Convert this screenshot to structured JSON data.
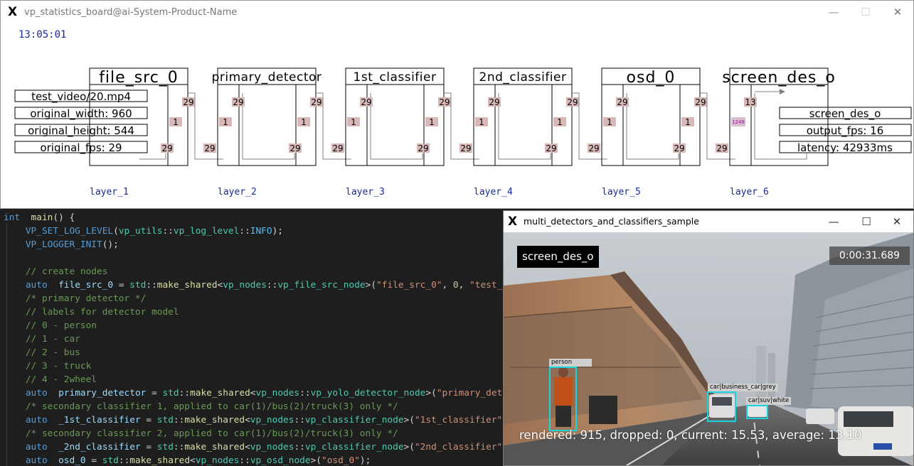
{
  "stats_window": {
    "title": "vp_statistics_board@ai-System-Product-Name",
    "clock": "13:05:01",
    "controls": {
      "minimize": "—",
      "maximize": "☐",
      "close": "✕"
    }
  },
  "pipeline": {
    "nodes": [
      {
        "name": "file_src_0",
        "layer": "layer_1",
        "in_queue": "",
        "in_count": "",
        "out_count": "29",
        "out_queue": "29",
        "mid_count": "1",
        "mid_count_right": "",
        "top_count": "29",
        "top_count_left": ""
      },
      {
        "name": "primary_detector",
        "layer": "layer_2",
        "in_count": "29",
        "mid_count_left": "1",
        "top_count_left": "29",
        "top_count": "29",
        "mid_count": "1",
        "out_count": "29"
      },
      {
        "name": "1st_classifier",
        "layer": "layer_3",
        "in_count": "29",
        "mid_count_left": "1",
        "top_count_left": "29",
        "top_count": "29",
        "mid_count": "1",
        "out_count": "29"
      },
      {
        "name": "2nd_classifier",
        "layer": "layer_4",
        "in_count": "29",
        "mid_count_left": "1",
        "top_count_left": "29",
        "top_count": "29",
        "mid_count": "1",
        "out_count": "29"
      },
      {
        "name": "osd_0",
        "layer": "layer_5",
        "in_count": "29",
        "mid_count_left": "1",
        "top_count_left": "29",
        "top_count": "29",
        "mid_count": "1",
        "out_count": "29"
      },
      {
        "name": "screen_des_o",
        "layer": "layer_6",
        "in_count": "29",
        "mid_count_left": "1248",
        "top_count_left": "13"
      }
    ],
    "src_info": [
      "test_video/20.mp4",
      "original_width: 960",
      "original_height: 544",
      "original_fps: 29"
    ],
    "des_info": [
      "screen_des_o",
      "output_fps: 16",
      "latency: 42933ms"
    ]
  },
  "code": {
    "lines": [
      [
        [
          "kw",
          "int"
        ],
        [
          "",
          "  "
        ],
        [
          "fn",
          "main"
        ],
        [
          "",
          "() {"
        ]
      ],
      [
        [
          "",
          "    "
        ],
        [
          "mac",
          "VP_SET_LOG_LEVEL"
        ],
        [
          "",
          "("
        ],
        [
          "ty",
          "vp_utils"
        ],
        [
          "",
          "::"
        ],
        [
          "ty",
          "vp_log_level"
        ],
        [
          "",
          "::"
        ],
        [
          "en",
          "INFO"
        ],
        [
          "",
          ");"
        ]
      ],
      [
        [
          "",
          "    "
        ],
        [
          "mac",
          "VP_LOGGER_INIT"
        ],
        [
          "",
          "();"
        ]
      ],
      [
        [
          "",
          ""
        ]
      ],
      [
        [
          "",
          "    "
        ],
        [
          "cmt",
          "// create nodes"
        ]
      ],
      [
        [
          "",
          "    "
        ],
        [
          "kw",
          "auto"
        ],
        [
          "",
          "  "
        ],
        [
          "var",
          "file_src_0"
        ],
        [
          "",
          " = "
        ],
        [
          "ty",
          "std"
        ],
        [
          "",
          "::"
        ],
        [
          "fn",
          "make_shared"
        ],
        [
          "",
          "<"
        ],
        [
          "ty",
          "vp_nodes"
        ],
        [
          "",
          "::"
        ],
        [
          "ty",
          "vp_file_src_node"
        ],
        [
          "",
          ">("
        ],
        [
          "str",
          "\"file_src_0\""
        ],
        [
          "",
          ", "
        ],
        [
          "num",
          "0"
        ],
        [
          "",
          ", "
        ],
        [
          "str",
          "\"test_v"
        ]
      ],
      [
        [
          "",
          "    "
        ],
        [
          "cmt",
          "/* primary detector */"
        ]
      ],
      [
        [
          "",
          "    "
        ],
        [
          "cmt",
          "// labels for detector model"
        ]
      ],
      [
        [
          "",
          "    "
        ],
        [
          "cmt",
          "// 0 - person"
        ]
      ],
      [
        [
          "",
          "    "
        ],
        [
          "cmt",
          "// 1 - car"
        ]
      ],
      [
        [
          "",
          "    "
        ],
        [
          "cmt",
          "// 2 - bus"
        ]
      ],
      [
        [
          "",
          "    "
        ],
        [
          "cmt",
          "// 3 - truck"
        ]
      ],
      [
        [
          "",
          "    "
        ],
        [
          "cmt",
          "// 4 - 2wheel"
        ]
      ],
      [
        [
          "",
          "    "
        ],
        [
          "kw",
          "auto"
        ],
        [
          "",
          "  "
        ],
        [
          "var",
          "primary_detector"
        ],
        [
          "",
          " = "
        ],
        [
          "ty",
          "std"
        ],
        [
          "",
          "::"
        ],
        [
          "fn",
          "make_shared"
        ],
        [
          "",
          "<"
        ],
        [
          "ty",
          "vp_nodes"
        ],
        [
          "",
          "::"
        ],
        [
          "ty",
          "vp_yolo_detector_node"
        ],
        [
          "",
          ">("
        ],
        [
          "str",
          "\"primary_dete"
        ]
      ],
      [
        [
          "",
          "    "
        ],
        [
          "cmt",
          "/* secondary classifier 1, applied to car(1)/bus(2)/truck(3) only */"
        ]
      ],
      [
        [
          "",
          "    "
        ],
        [
          "kw",
          "auto"
        ],
        [
          "",
          "  "
        ],
        [
          "var",
          "_1st_classifier"
        ],
        [
          "",
          " = "
        ],
        [
          "ty",
          "std"
        ],
        [
          "",
          "::"
        ],
        [
          "fn",
          "make_shared"
        ],
        [
          "",
          "<"
        ],
        [
          "ty",
          "vp_nodes"
        ],
        [
          "",
          "::"
        ],
        [
          "ty",
          "vp_classifier_node"
        ],
        [
          "",
          ">("
        ],
        [
          "str",
          "\"1st_classifier\""
        ],
        [
          "",
          ","
        ]
      ],
      [
        [
          "",
          "    "
        ],
        [
          "cmt",
          "/* secondary classifier 2, applied to car(1)/bus(2)/truck(3) only */"
        ]
      ],
      [
        [
          "",
          "    "
        ],
        [
          "kw",
          "auto"
        ],
        [
          "",
          "  "
        ],
        [
          "var",
          "_2nd_classifier"
        ],
        [
          "",
          " = "
        ],
        [
          "ty",
          "std"
        ],
        [
          "",
          "::"
        ],
        [
          "fn",
          "make_shared"
        ],
        [
          "",
          "<"
        ],
        [
          "ty",
          "vp_nodes"
        ],
        [
          "",
          "::"
        ],
        [
          "ty",
          "vp_classifier_node"
        ],
        [
          "",
          ">("
        ],
        [
          "str",
          "\"2nd_classifier\""
        ],
        [
          "",
          ","
        ]
      ],
      [
        [
          "",
          "    "
        ],
        [
          "kw",
          "auto"
        ],
        [
          "",
          "  "
        ],
        [
          "var",
          "osd_0"
        ],
        [
          "",
          " = "
        ],
        [
          "ty",
          "std"
        ],
        [
          "",
          "::"
        ],
        [
          "fn",
          "make_shared"
        ],
        [
          "",
          "<"
        ],
        [
          "ty",
          "vp_nodes"
        ],
        [
          "",
          "::"
        ],
        [
          "ty",
          "vp_osd_node"
        ],
        [
          "",
          ">("
        ],
        [
          "str",
          "\"osd_0\""
        ],
        [
          "",
          ");"
        ]
      ]
    ]
  },
  "video_window": {
    "title": "multi_detectors_and_classifiers_sample",
    "controls": {
      "minimize": "—",
      "maximize": "☐",
      "close": "✕"
    },
    "osd_label": "screen_des_o",
    "timestamp": "0:00:31.689",
    "detections": {
      "person": "person",
      "car1": "car|business_car|grey",
      "car2": "car|suv|white"
    },
    "stats_line": "rendered: 915, dropped: 0, current: 15.53, average: 13.10"
  }
}
